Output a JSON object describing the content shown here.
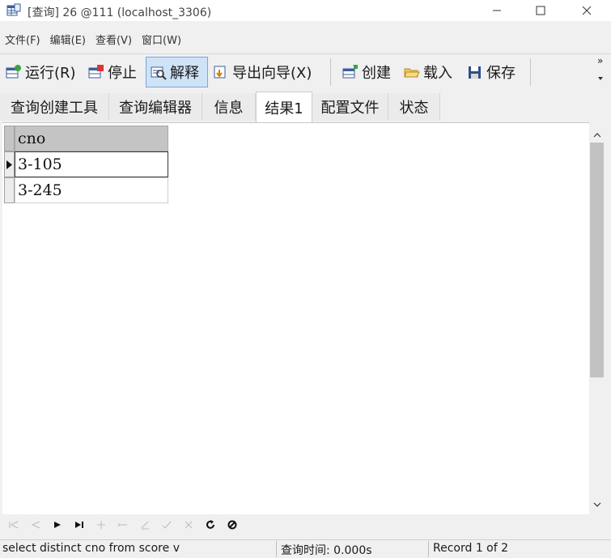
{
  "window": {
    "title": "[查询] 26 @111 (localhost_3306)"
  },
  "menu": [
    "文件(F)",
    "编辑(E)",
    "查看(V)",
    "窗口(W)"
  ],
  "toolbar": {
    "run": "运行(R)",
    "stop": "停止",
    "explain": "解释",
    "export_wizard": "导出向导(X)",
    "create": "创建",
    "load": "载入",
    "save": "保存",
    "overflow": "»"
  },
  "tabs": [
    "查询创建工具",
    "查询编辑器",
    "信息",
    "结果1",
    "配置文件",
    "状态"
  ],
  "active_tab": "结果1",
  "grid": {
    "column": "cno",
    "rows": [
      "3-105",
      "3-245"
    ]
  },
  "status": {
    "sql": "select distinct cno from score v",
    "query_time": "查询时间: 0.000s",
    "record": "Record 1 of 2"
  },
  "colors": {
    "active_toolbar_bg": "#cfe3f7",
    "header_bg": "#c4c4c4"
  }
}
